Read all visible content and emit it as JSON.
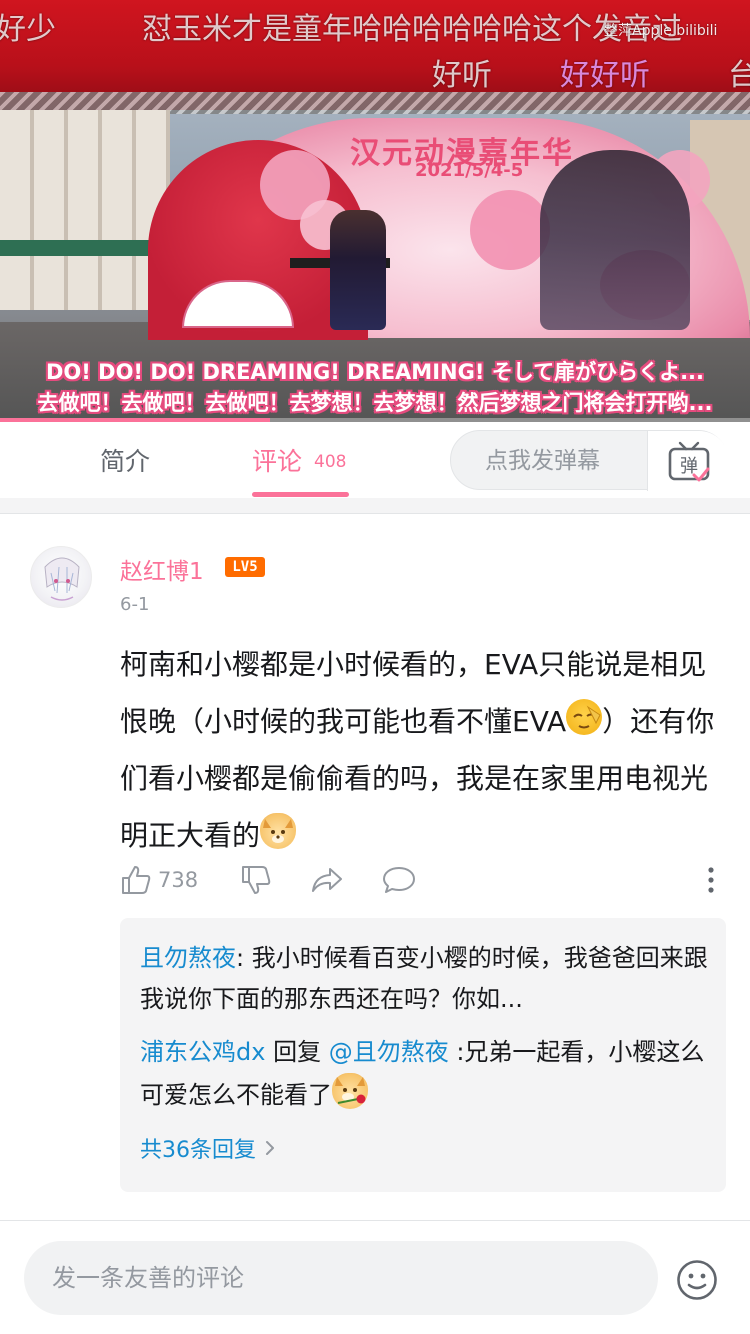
{
  "video": {
    "danmaku": [
      "好少",
      "怼玉米才是童年哈哈哈哈哈哈这个发音过",
      "好听",
      "好好听",
      "台"
    ],
    "watermark": "整萍Apple bilibili",
    "stage_title": "汉元动漫嘉年华",
    "stage_date": "2021/5/4-5",
    "subtitle_line1": "DO! DO! DO! DREAMING! DREAMING! そして扉がひらくよ...",
    "subtitle_line2": "去做吧！去做吧！去做吧！去梦想！去梦想！然后梦想之门将会打开哟...",
    "progress_fraction": 0.36
  },
  "tabs": {
    "intro_label": "简介",
    "comments_label": "评论",
    "comments_count": "408",
    "danmaku_placeholder": "点我发弹幕",
    "danmaku_toggle_char": "弹"
  },
  "comment": {
    "username": "赵红博1",
    "level": "LV5",
    "date": "6-1",
    "text_part1": "柯南和小樱都是小时候看的，EVA只能说是相见恨晚（小时候的我可能也看不懂EVA",
    "text_part2": "）还有你们看小樱都是偷偷看的吗，我是在家里用电视光明正大看的",
    "like_count": "738",
    "replies": [
      {
        "author": "且勿熬夜",
        "text": ": 我小时候看百变小樱的时候，我爸爸回来跟我说你下面的那东西还在吗？你如..."
      },
      {
        "author": "浦东公鸡dx",
        "reply_word": " 回复 ",
        "mention": "@且勿熬夜",
        "text": " :兄弟一起看，小樱这么可爱怎么不能看了"
      }
    ],
    "more_replies": "共36条回复"
  },
  "bottom": {
    "input_placeholder": "发一条友善的评论"
  },
  "colors": {
    "accent_pink": "#fb7299",
    "link_blue": "#178bcf",
    "level_orange": "#ff6c00"
  },
  "icons": [
    "thumbs-up-icon",
    "thumbs-down-icon",
    "share-icon",
    "reply-icon",
    "more-icon",
    "danmaku-toggle-icon",
    "chevron-right-icon",
    "emoji-smile-icon"
  ]
}
